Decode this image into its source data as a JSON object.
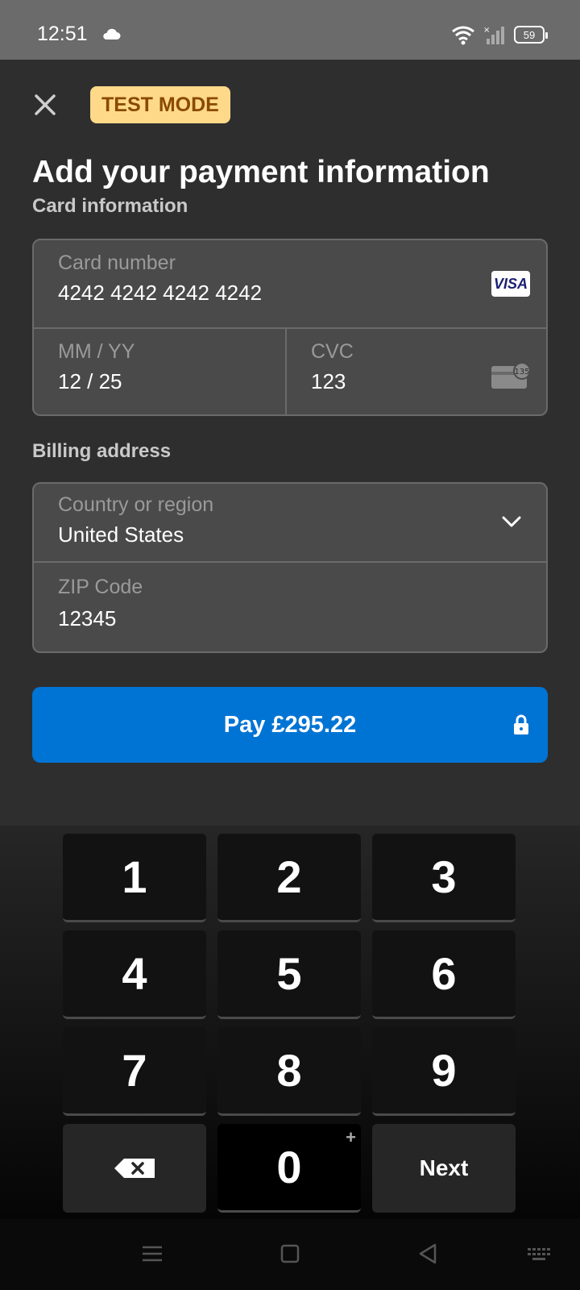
{
  "status_bar": {
    "time": "12:51",
    "battery": "59",
    "icons": [
      "cloud-icon",
      "wifi-icon",
      "signal-icon",
      "battery-icon"
    ]
  },
  "header": {
    "close_icon": "close-icon",
    "badge": "TEST MODE",
    "title": "Add your payment information"
  },
  "card": {
    "section_label": "Card information",
    "number": {
      "label": "Card number",
      "value": "4242 4242 4242 4242",
      "brand": "VISA"
    },
    "expiry": {
      "label": "MM / YY",
      "value": "12 / 25"
    },
    "cvc": {
      "label": "CVC",
      "value": "123",
      "icon_badge": "135"
    }
  },
  "billing": {
    "section_label": "Billing address",
    "country": {
      "label": "Country or region",
      "value": "United States"
    },
    "zip": {
      "label": "ZIP Code",
      "value": "12345"
    }
  },
  "pay_button": {
    "label": "Pay £295.22"
  },
  "keyboard": {
    "keys": [
      "1",
      "2",
      "3",
      "4",
      "5",
      "6",
      "7",
      "8",
      "9"
    ],
    "zero": "0",
    "zero_hint": "+",
    "next": "Next"
  },
  "colors": {
    "accent": "#0074d4",
    "badge_bg": "#ffd98a",
    "badge_text": "#8a4a00",
    "background": "#2e2e2e"
  }
}
